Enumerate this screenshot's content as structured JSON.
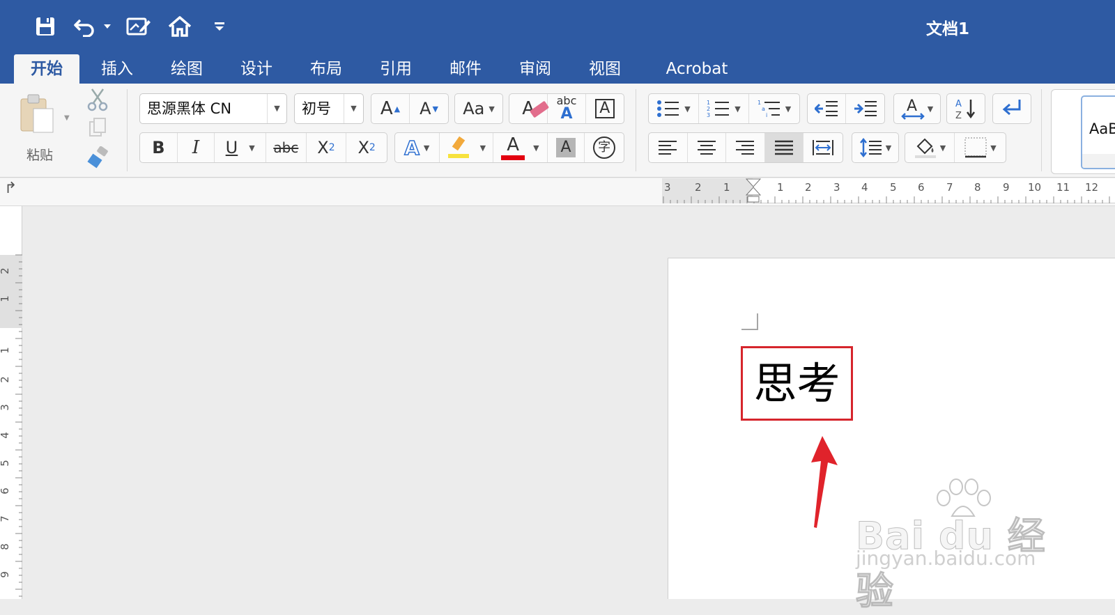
{
  "window": {
    "title": "文档1"
  },
  "quick_access": {
    "icons": [
      "save-icon",
      "undo-icon",
      "dropdown-caret-icon",
      "edit-document-icon",
      "home-icon",
      "customize-toolbar-icon"
    ]
  },
  "tabs": [
    {
      "label": "开始",
      "active": true
    },
    {
      "label": "插入"
    },
    {
      "label": "绘图"
    },
    {
      "label": "设计"
    },
    {
      "label": "布局"
    },
    {
      "label": "引用"
    },
    {
      "label": "邮件"
    },
    {
      "label": "审阅"
    },
    {
      "label": "视图"
    },
    {
      "label": "Acrobat"
    }
  ],
  "clipboard": {
    "paste_label": "粘贴"
  },
  "font": {
    "family": "思源黑体 CN",
    "size": "初号"
  },
  "format_buttons": {
    "bold": "B",
    "italic": "I",
    "underline": "U",
    "strike": "abc",
    "subscript": "X",
    "subscript_mark": "2",
    "superscript": "X",
    "superscript_mark": "2",
    "grow": "A",
    "shrink": "A",
    "change_case": "Aa",
    "clear": "A",
    "phonetic_top": "abc",
    "phonetic_bottom": "A",
    "border_char": "A",
    "text_effects": "A",
    "font_color": "A",
    "char_shading": "A",
    "enclose": "字"
  },
  "styles": {
    "preview": "AaB"
  },
  "ruler": {
    "horizontal_left": [
      "3",
      "2",
      "1"
    ],
    "horizontal_right": [
      "1",
      "2",
      "3",
      "4",
      "5",
      "6",
      "7",
      "8",
      "9",
      "10",
      "11",
      "12"
    ],
    "vertical": [
      "2",
      "1",
      "1",
      "2",
      "3",
      "4",
      "5",
      "6",
      "7",
      "8",
      "9"
    ],
    "corner_glyph": "↱"
  },
  "document": {
    "text": "思考"
  },
  "watermark": {
    "main": "Bai du 经验",
    "sub": "jingyan.baidu.com"
  },
  "colors": {
    "title_bar": "#2e5aa3",
    "highlight_box": "#d6252c",
    "arrow": "#e0232b",
    "font_color_bar": "#e3000f",
    "highlight_yellow": "#f7e23d"
  }
}
